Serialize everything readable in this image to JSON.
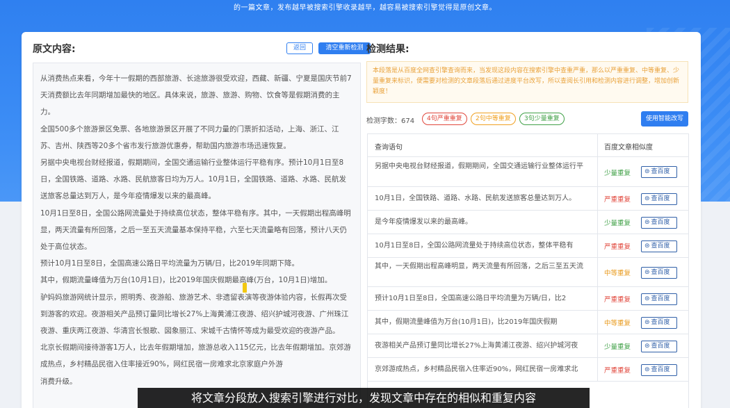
{
  "banner": {
    "text": "的一篇文章，发布越早被搜索引擎收录越早，越容易被搜索引擎觉得是原创文章。"
  },
  "left_panel": {
    "title": "原文内容:",
    "back_label": "返回",
    "recheck_label": "清空重新检测",
    "paragraphs": [
      "从消费热点来看，今年十一假期的西部旅游、长途旅游很受欢迎，西藏、新疆、宁夏是国庆节前7天消费额比去年同期增加最快的地区。具体来说，旅游、旅游、购物、饮食等是假期消费的主力。",
      "全国500多个旅游景区免票、各地旅游景区开展了不同力量的门票折扣活动，上海、浙江、江苏、吉州、陕西等20多个省市发行旅游优惠券，帮助国内旅游市场迅速恢复。",
      "另据中央电视台财经报道，假期期间，全国交通运输行业整体运行平稳有序。预计10月1日至8日，全国铁路、道路、水路、民航旅客日均为万人。10月1日，全国铁路、道路、水路、民航发送旅客总量达到万人，是今年疫情爆发以来的最高峰。",
      "10月1日至8日，全国公路网流量处于持续高位状态，整体平稳有序。其中，一天假期出程高峰明显，两天流量有所回落，之后一至五天流量基本保持平稳，六至七天流量略有回落，预计八天仍处于高位状态。",
      "预计10月1日至8日，全国高速公路日平均流量为万辆/日，比2019年同期下降。",
      "其中，假期流量峰值为万台(10月1日)，比2019年国庆假期最高峰(万台，10月1日)增加。",
      "驴妈妈旅游网统计显示，照明秀、夜游船、旅游艺术、非遗留表演等夜游体验内容，长假再次受到游客的欢迎。夜游相关产品预订量同比增长27%上海黄浦江夜游、绍兴护城河夜游、广州珠江夜游、重庆两江夜游、华清宫长恨歌、図象丽江、宋城千古情怀等成为最受欢迎的夜游产品。",
      "北京长假期间接待游客1万人，比去年假期增加，旅游总收入115亿元，比去年假期增加。京郊游成热点，乡村精品民宿入住率接近90%，网红民宿一房难求北京家庭户外游",
      "消费升级。"
    ]
  },
  "right_panel": {
    "title": "检测结果:",
    "notice": "本段落是从百度全网查引擎查询而来，当发现这段内容在搜索引擎中查重严重，那么以严重重复、中等重复、少量重复来标识，便需要对检测的文章段落后通过进度平台改写，所以查阅长引用和检测内容进行调整，增加创新颖度！",
    "char_count_label": "检测字数：",
    "char_count": "674",
    "severe_pill": "4句严重重复",
    "medium_pill": "2句中等重复",
    "light_pill": "3句少量重复",
    "rewrite_label": "使用智能改写",
    "col_sentence": "查询语句",
    "col_similarity": "百度文章相似度",
    "check_label": "查百度",
    "rows": [
      {
        "sentence": "另据中央电视台财经报道，假期期间，全国交通运输行业整体运行平",
        "level": "少量重复",
        "tone": "green"
      },
      {
        "sentence": "10月1日，全国铁路、道路、水路、民航发送旅客总量达到万人。",
        "level": "严重重复",
        "tone": "red"
      },
      {
        "sentence": "是今年疫情爆发以来的最高峰。",
        "level": "少量重复",
        "tone": "green"
      },
      {
        "sentence": "10月1日至8日，全国公路网流量处于持续高位状态，整体平稳有",
        "level": "严重重复",
        "tone": "red"
      },
      {
        "sentence": "其中，一天假期出程高峰明显，两天流量有所回落，之后三至五天流",
        "level": "中等重复",
        "tone": "orange"
      },
      {
        "sentence": "预计10月1日至8日，全国高速公路日平均流量为万辆/日，比2",
        "level": "严重重复",
        "tone": "red"
      },
      {
        "sentence": "其中，假期流量峰值为万台(10月1日)，比2019年国庆假期",
        "level": "中等重复",
        "tone": "orange"
      },
      {
        "sentence": "夜游相关产品预订量同比增长27%上海黄浦江夜游、绍兴护城河夜",
        "level": "少量重复",
        "tone": "green"
      },
      {
        "sentence": "京郊游成热点，乡村精品民宿入住率近90%，网红民宿一房难求北",
        "level": "严重重复",
        "tone": "red"
      }
    ]
  },
  "subtitle": "将文章分段放入搜索引擎进行对比，发现文章中存在的相似和重复内容",
  "colors": {
    "primary": "#2f7ef0",
    "severe": "#e0463b",
    "medium": "#f0a020",
    "light": "#3fa046"
  }
}
